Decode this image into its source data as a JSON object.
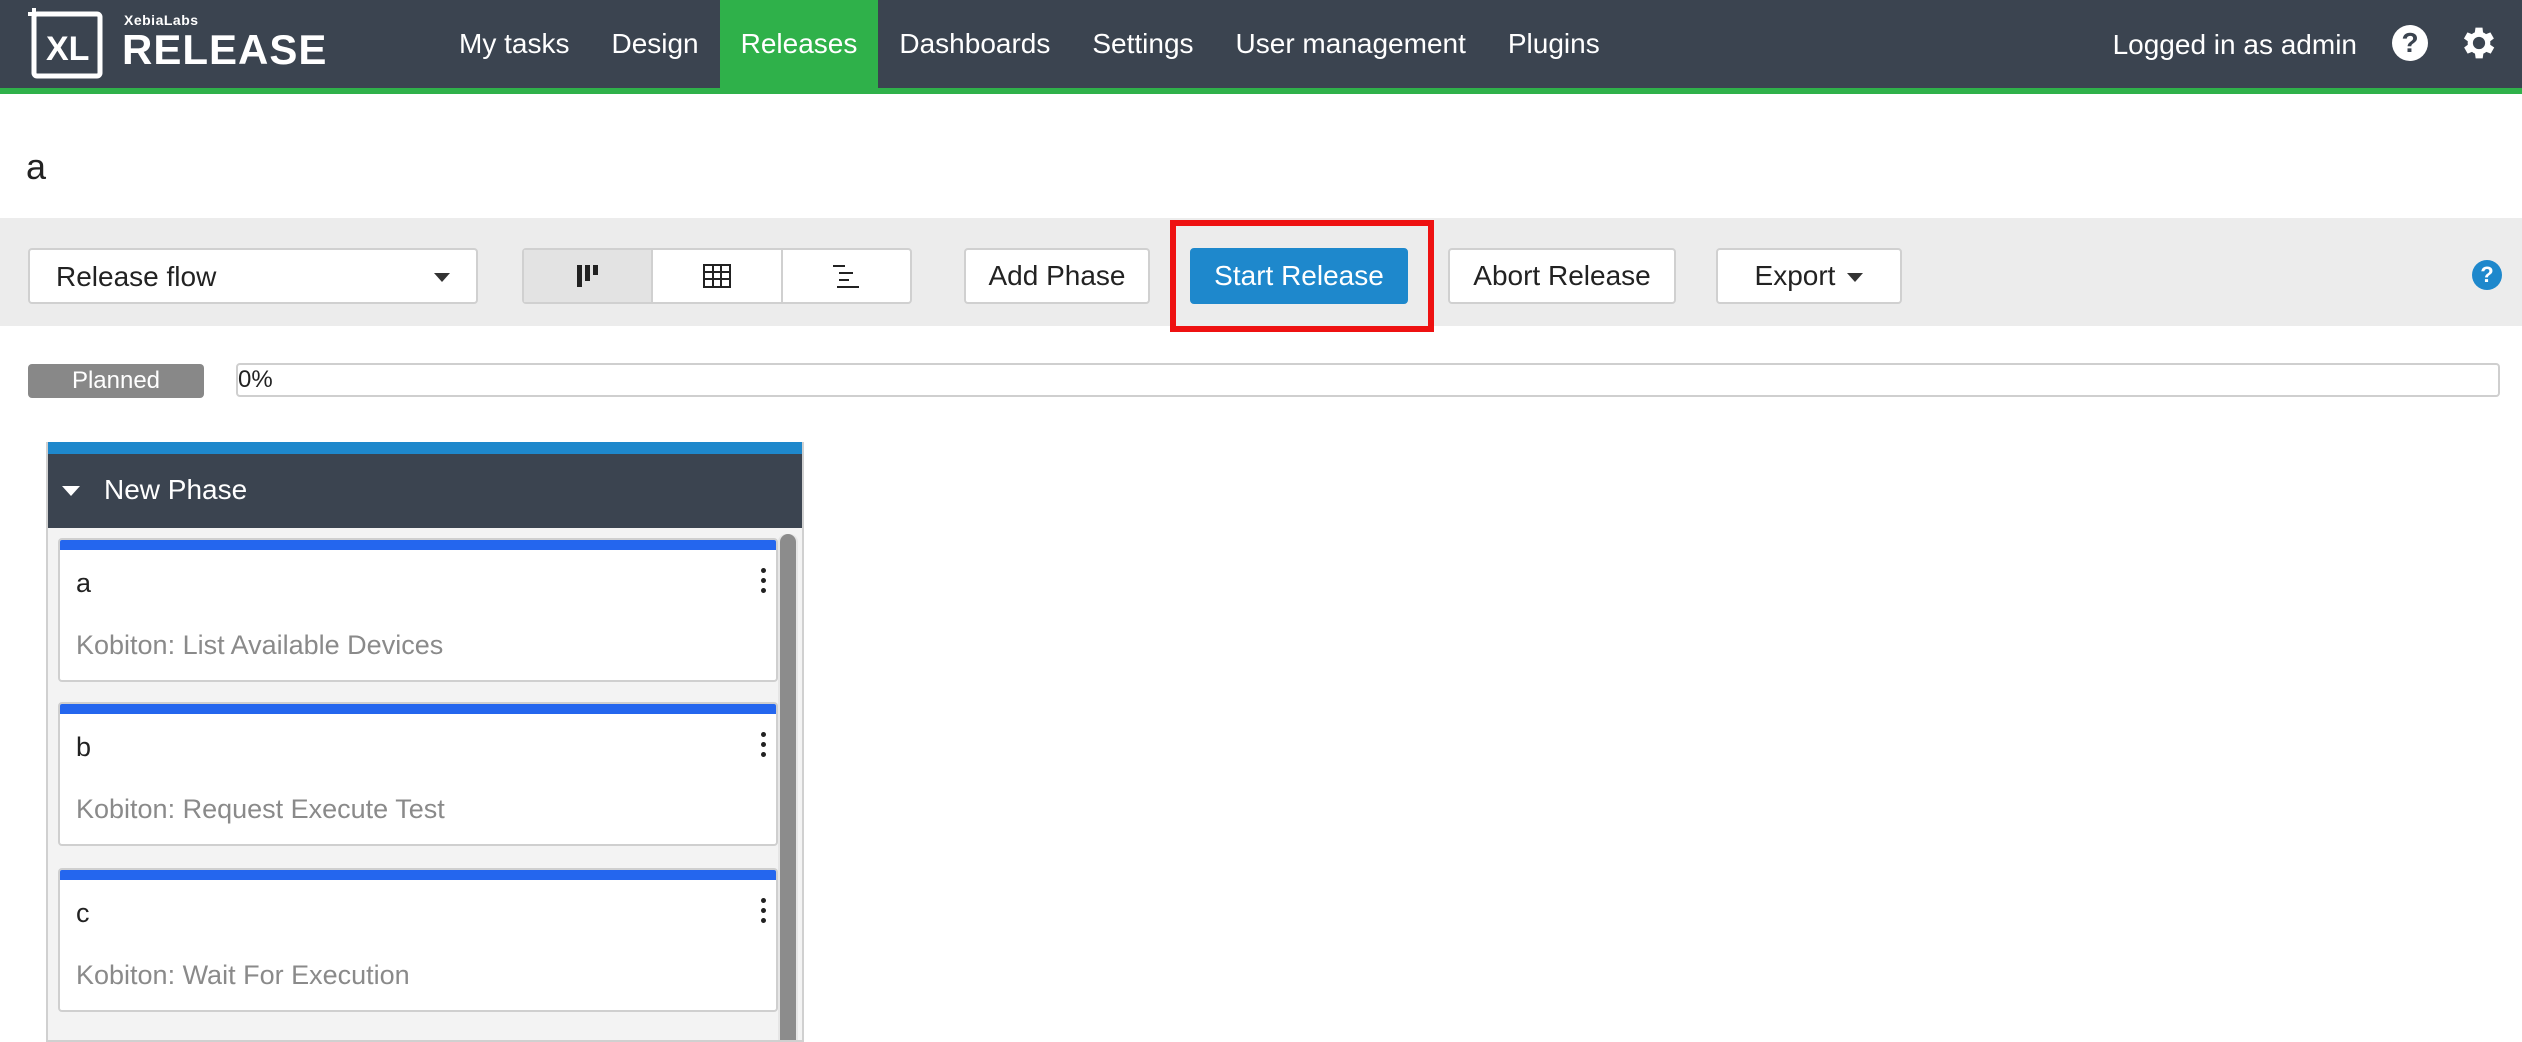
{
  "app": {
    "logo_vendor": "XebiaLabs",
    "logo_product": "RELEASE",
    "logo_mark": "XL"
  },
  "nav": {
    "items": [
      {
        "label": "My tasks"
      },
      {
        "label": "Design"
      },
      {
        "label": "Releases",
        "active": true
      },
      {
        "label": "Dashboards"
      },
      {
        "label": "Settings"
      },
      {
        "label": "User management"
      },
      {
        "label": "Plugins"
      }
    ],
    "user_label": "Logged in as admin",
    "help_icon": "question-circle-icon",
    "settings_icon": "gear-icon"
  },
  "page": {
    "title": "a"
  },
  "toolbar": {
    "view_select": "Release flow",
    "view_modes": [
      "board-view-icon",
      "table-view-icon",
      "gantt-view-icon"
    ],
    "add_phase": "Add Phase",
    "start_release": "Start Release",
    "abort_release": "Abort Release",
    "export": "Export"
  },
  "status": {
    "state": "Planned",
    "progress_label": "0%",
    "progress": 0
  },
  "phase": {
    "name": "New Phase",
    "tasks": [
      {
        "title": "a",
        "description": "Kobiton: List Available Devices"
      },
      {
        "title": "b",
        "description": "Kobiton: Request Execute Test"
      },
      {
        "title": "c",
        "description": "Kobiton: Wait For Execution"
      }
    ]
  },
  "colors": {
    "nav_bg": "#3b4450",
    "accent_green": "#2fb14a",
    "primary_blue": "#1e88cc",
    "task_bar": "#2466ee",
    "highlight_red": "#ee1111"
  }
}
